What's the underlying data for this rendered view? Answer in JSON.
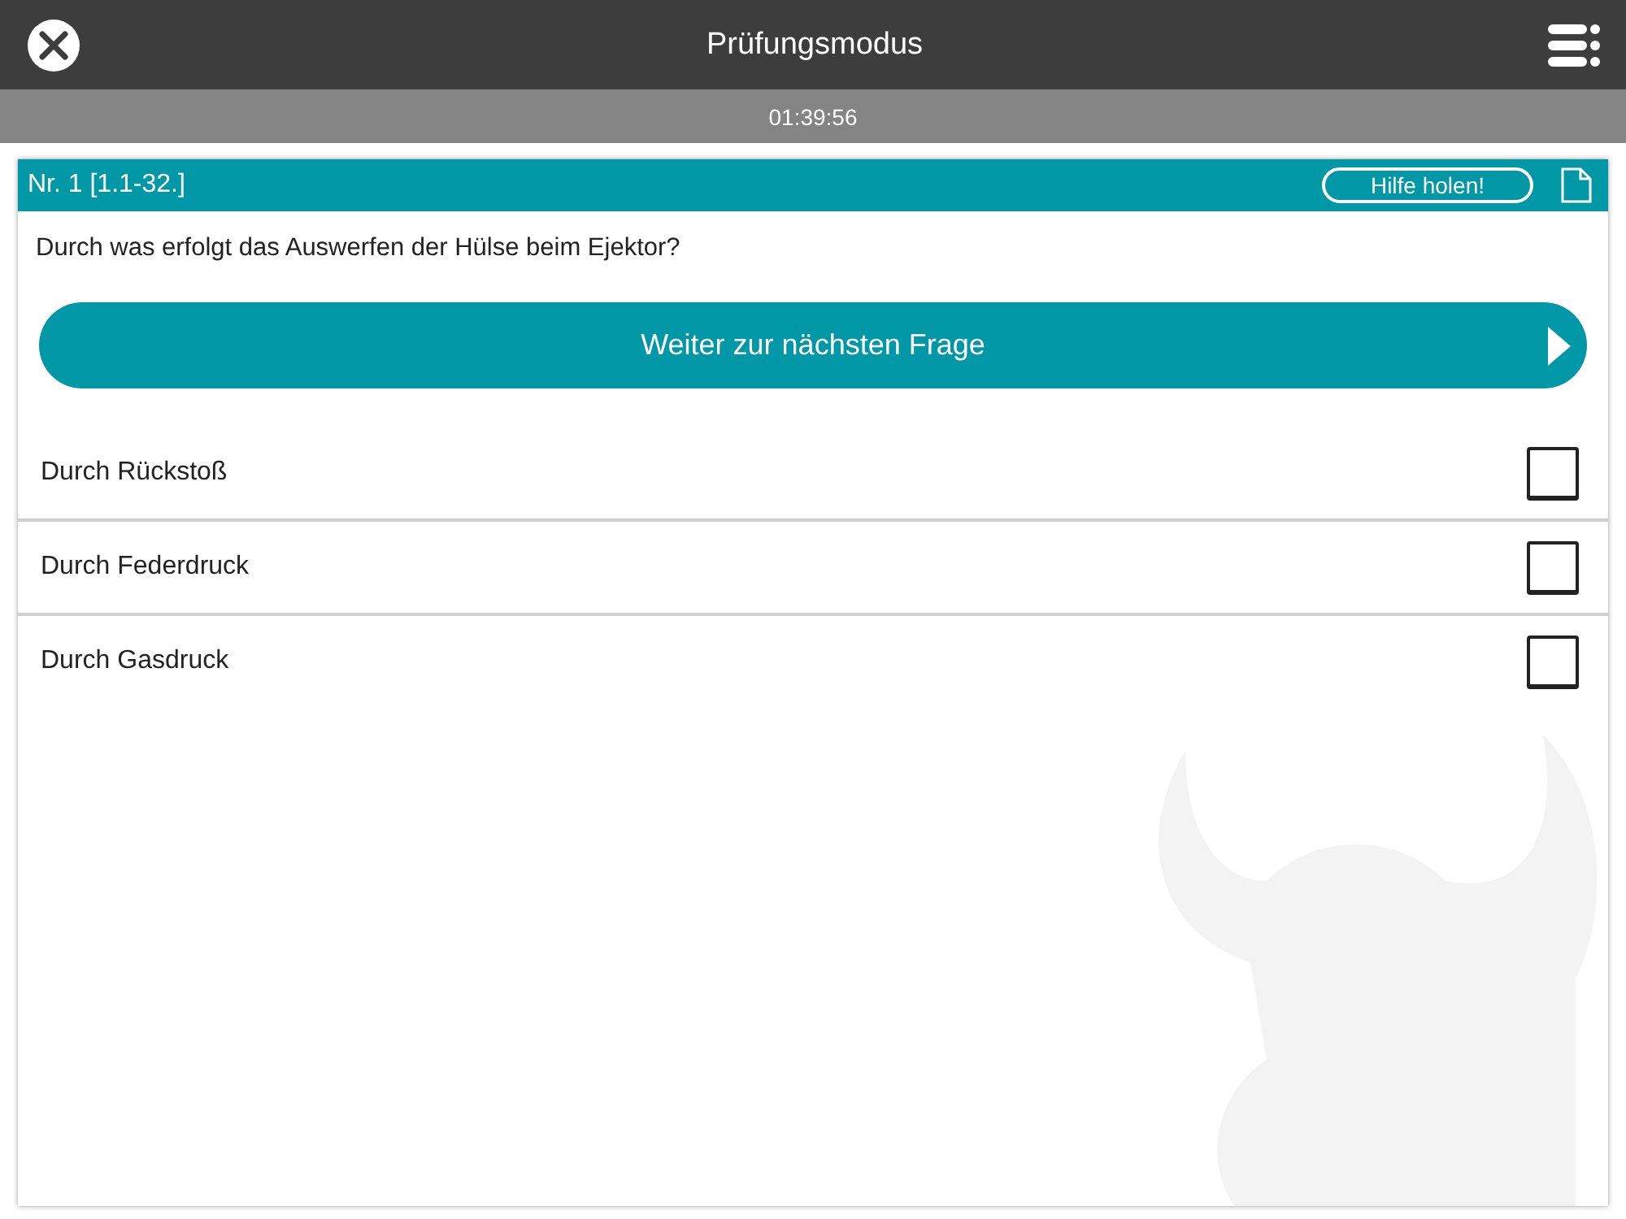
{
  "header": {
    "title": "Prüfungsmodus"
  },
  "timer": "01:39:56",
  "question": {
    "number": "Nr. 1 [1.1-32.]",
    "help_button": "Hilfe holen!",
    "text": "Durch was erfolgt das Auswerfen der Hülse beim Ejektor?",
    "next_button": "Weiter zur nächsten Frage"
  },
  "answers": [
    {
      "label": "Durch Rückstoß",
      "checked": false
    },
    {
      "label": "Durch Federdruck",
      "checked": false
    },
    {
      "label": "Durch Gasdruck",
      "checked": false
    }
  ]
}
